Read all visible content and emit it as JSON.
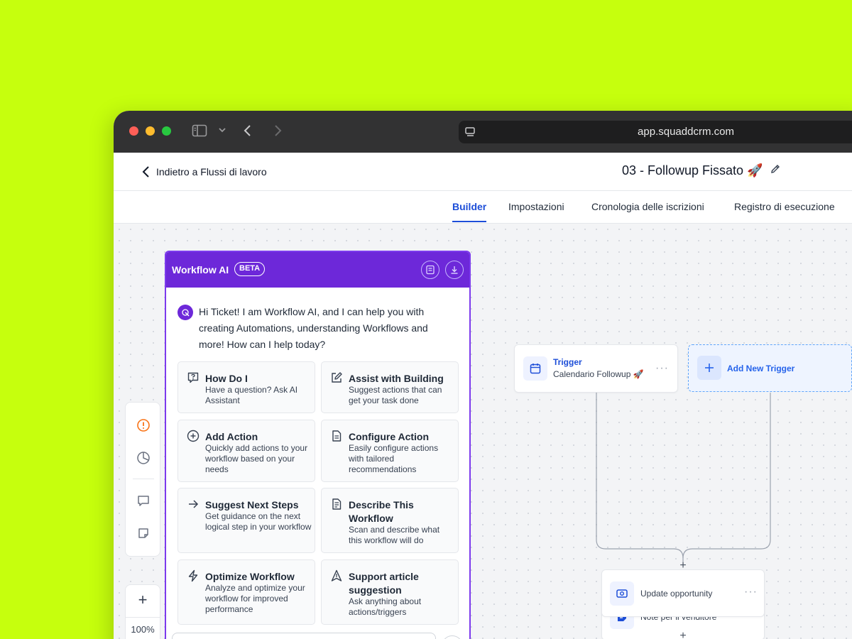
{
  "browser": {
    "url": "app.squaddcrm.com"
  },
  "header": {
    "back_label": "Indietro a Flussi di lavoro",
    "title": "03 - Followup Fissato 🚀"
  },
  "tabs": [
    {
      "label": "Builder"
    },
    {
      "label": "Impostazioni"
    },
    {
      "label": "Cronologia delle iscrizioni"
    },
    {
      "label": "Registro di esecuzione"
    }
  ],
  "ai": {
    "title": "Workflow AI",
    "badge": "BETA",
    "greeting": "Hi Ticket! I am Workflow AI, and I can help you with creating Automations, understanding Workflows and more! How can I help today?",
    "cards": [
      {
        "title": "How Do I",
        "desc": "Have a question? Ask AI Assistant",
        "icon": "question-icon"
      },
      {
        "title": "Assist with Building",
        "desc": "Suggest actions that can get your task done",
        "icon": "edit-icon"
      },
      {
        "title": "Add Action",
        "desc": "Quickly add actions to your workflow based on your needs",
        "icon": "plus-circle-icon"
      },
      {
        "title": "Configure Action",
        "desc": "Easily configure actions with tailored recommendations",
        "icon": "document-icon"
      },
      {
        "title": "Suggest Next Steps",
        "desc": "Get guidance on the next logical step in your workflow",
        "icon": "arrow-right-icon"
      },
      {
        "title": "Describe This Workflow",
        "desc": "Scan and describe what this workflow will do",
        "icon": "document-text-icon"
      },
      {
        "title": "Optimize Workflow",
        "desc": "Analyze and optimize your workflow for improved performance",
        "icon": "lightning-icon"
      },
      {
        "title": "Support article suggestion",
        "desc": "Ask anything about actions/triggers",
        "icon": "navigation-icon"
      }
    ]
  },
  "zoom": {
    "level": "100%",
    "plus": "+"
  },
  "workflow": {
    "trigger": {
      "label": "Trigger",
      "name": "Calendario Followup 🚀",
      "menu": "···"
    },
    "new_trigger": {
      "label": "Add New Trigger"
    },
    "actions": [
      {
        "name": "Note per il venditore",
        "menu": "···"
      },
      {
        "name": "Update opportunity",
        "menu": "···"
      }
    ],
    "plus": "+"
  },
  "colors": {
    "accent": "#1d4ed8",
    "ai_purple": "#6d28d9",
    "background": "#c6ff0d"
  }
}
